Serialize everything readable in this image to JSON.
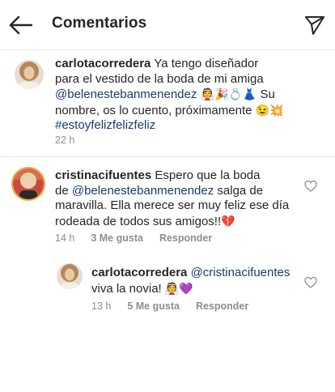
{
  "header": {
    "title": "Comentarios"
  },
  "caption": {
    "username": "carlotacorredera",
    "line1": "Ya tengo diseñador",
    "line2": "para el vestido de la boda de mi amiga",
    "mention": "@belenestebanmenendez",
    "emojis1": "👰🎉💍👗",
    "line3a": "Su",
    "line3b": "nombre, os lo cuento, próximamente",
    "emojis2": "😉💥",
    "hashtag": "#estoyfelizfelizfeliz",
    "time": "22 h"
  },
  "comments": [
    {
      "username": "cristinacifuentes",
      "text1": "Espero que la boda",
      "text2a": "de",
      "mention": "@belenestebanmenendez",
      "text2b": "salga de",
      "text3": "maravilla. Ella merece ser muy feliz ese día",
      "text4": "rodeada de todos sus amigos!!",
      "emoji": "💔",
      "time": "14 h",
      "likes": "3 Me gusta",
      "reply": "Responder"
    },
    {
      "username": "carlotacorredera",
      "mention": "@cristinacifuentes",
      "text2": "viva la novia!",
      "emoji": "👰💜",
      "time": "13 h",
      "likes": "5 Me gusta",
      "reply": "Responder"
    }
  ],
  "icons": {
    "back": "arrow-left-icon",
    "send": "paper-plane-icon",
    "like": "heart-outline-icon"
  }
}
